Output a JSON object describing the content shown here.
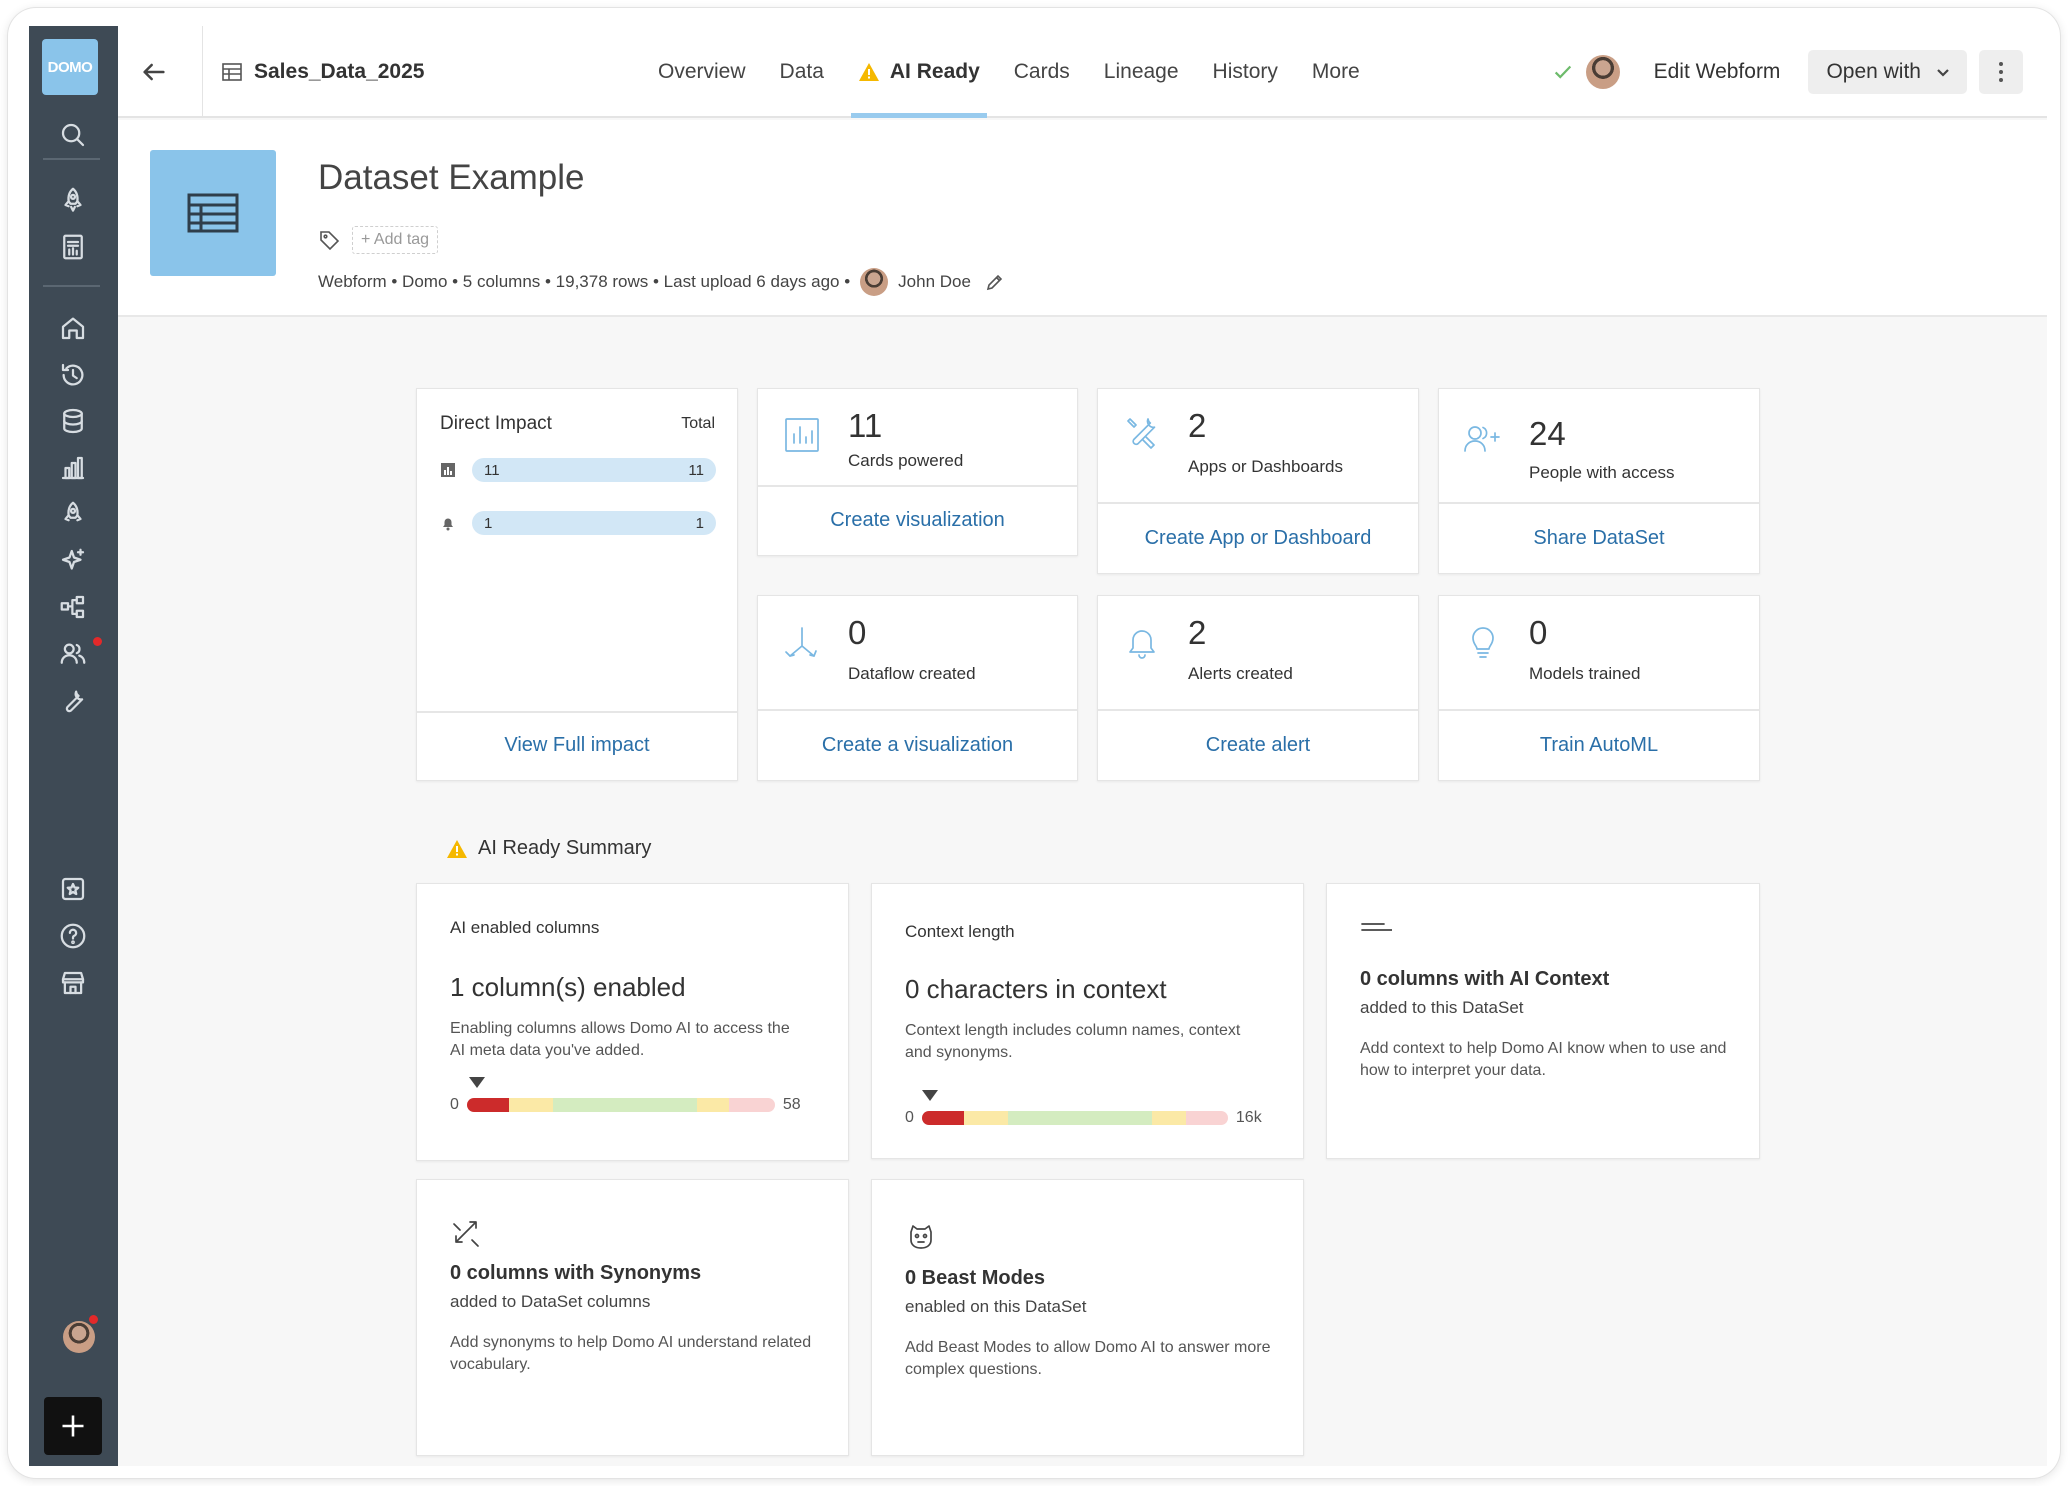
{
  "header": {
    "dataset_name": "Sales_Data_2025",
    "tabs": [
      {
        "label": "Overview"
      },
      {
        "label": "Data"
      },
      {
        "label": "AI Ready"
      },
      {
        "label": "Cards"
      },
      {
        "label": "Lineage"
      },
      {
        "label": "History"
      },
      {
        "label": "More"
      }
    ],
    "active_tab": "AI Ready",
    "edit_label": "Edit Webform",
    "open_with_label": "Open with"
  },
  "rail": {
    "logo_text": "DOMO",
    "icons": [
      "search-icon",
      "rocket-icon",
      "page-icon",
      "home-icon",
      "history-icon",
      "database-icon",
      "bar-chart-icon",
      "launch-icon",
      "sparkle-icon",
      "workflow-icon",
      "people-icon",
      "wrench-icon",
      "shield-icon",
      "help-icon",
      "store-icon"
    ]
  },
  "dataset": {
    "title": "Dataset Example",
    "add_tag": "+ Add tag",
    "meta": "Webform • Domo • 5 columns •  19,378 rows • Last upload 6 days ago •",
    "owner": "John Doe"
  },
  "impact": {
    "direct": {
      "title": "Direct Impact",
      "total_label": "Total",
      "rows": [
        {
          "icon": "card-icon",
          "left": "11",
          "right": "11"
        },
        {
          "icon": "bell-icon",
          "left": "1",
          "right": "1"
        }
      ],
      "link": "View Full impact"
    },
    "stats": [
      {
        "value": "11",
        "label": "Cards powered",
        "link": "Create visualization",
        "icon": "bar-card-icon"
      },
      {
        "value": "2",
        "label": "Apps or Dashboards",
        "link": "Create App or Dashboard",
        "icon": "tools-icon"
      },
      {
        "value": "24",
        "label": "People with access",
        "link": "Share DataSet",
        "icon": "people-add-icon"
      },
      {
        "value": "0",
        "label": "Dataflow created",
        "link": "Create a visualization",
        "icon": "dataflow-icon"
      },
      {
        "value": "2",
        "label": "Alerts created",
        "link": "Create alert",
        "icon": "bell-icon"
      },
      {
        "value": "0",
        "label": "Models trained",
        "link": "Train AutoML",
        "icon": "lightbulb-icon"
      }
    ]
  },
  "ai_summary": {
    "title": "AI Ready Summary",
    "enabled": {
      "caption": "AI enabled columns",
      "value_text": "1 column(s) enabled",
      "description": "Enabling columns allows Domo AI to access the AI meta data you've added.",
      "min": "0",
      "max": "58",
      "value": 1,
      "range_max": 58
    },
    "context": {
      "caption": "Context length",
      "value_text": "0 characters in context",
      "description": "Context length includes column names, context and synonyms.",
      "min": "0",
      "max": "16k",
      "value": 0,
      "range_max": 16000
    },
    "ai_context": {
      "heading": "0 columns with AI Context",
      "sub": "added to this DataSet",
      "description": "Add context to help Domo AI know when to use and how to interpret your data."
    },
    "synonyms": {
      "heading": "0 columns with Synonyms",
      "sub": "added to DataSet columns",
      "description": "Add synonyms to help Domo AI understand related vocabulary."
    },
    "beast_modes": {
      "heading": "0 Beast Modes",
      "sub": "enabled on this DataSet",
      "description": "Add Beast Modes to allow Domo AI to answer more complex questions."
    }
  },
  "colors": {
    "rail": "#3e4a55",
    "accent_blue": "#8ac4ea",
    "link": "#2a6fa8",
    "warning": "#f5b800",
    "gauge_red": "#cc2b2b",
    "gauge_yellow": "#fbe9a6",
    "gauge_green": "#d4ecc0",
    "gauge_pink": "#f9d3d3"
  }
}
